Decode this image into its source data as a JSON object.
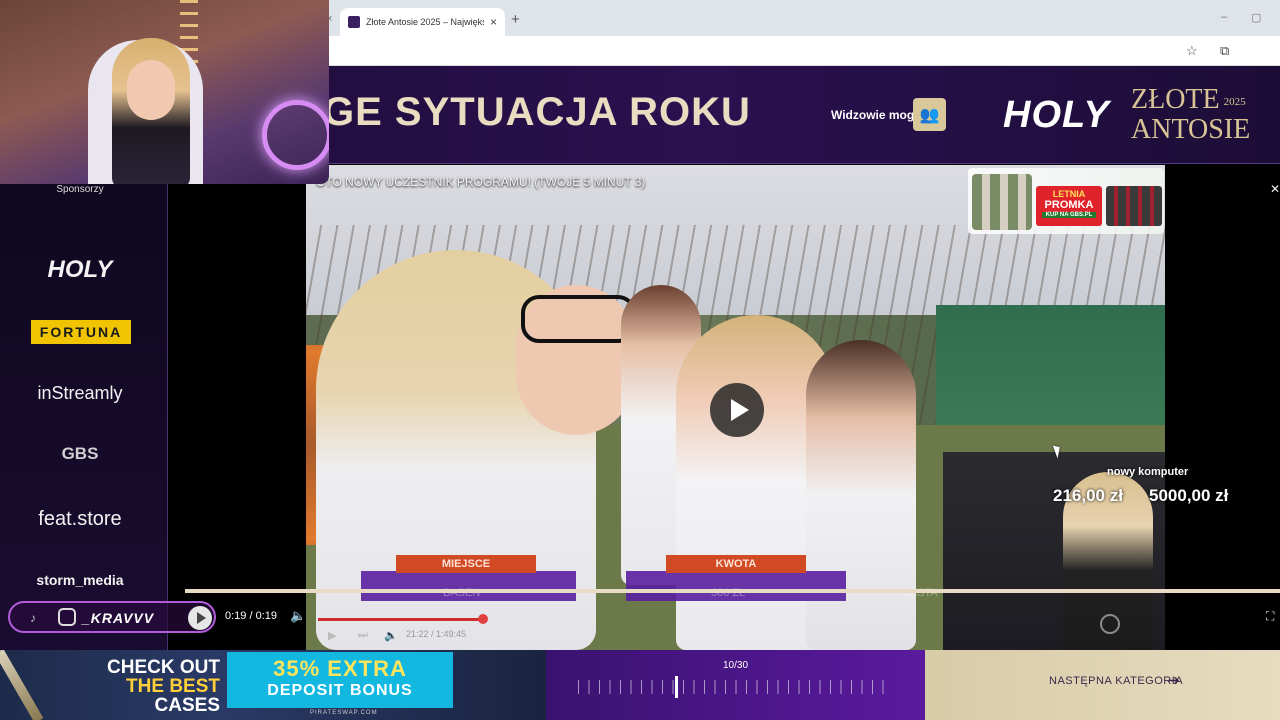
{
  "browser": {
    "tab_title": "Złote Antosie 2025 – Największ",
    "tab_close": "×",
    "prev_tab_close": "×",
    "new_tab": "+",
    "minimize": "–",
    "maximize": "▢",
    "star_icon": "☆",
    "extensions_icon": "⧉"
  },
  "header": {
    "category_title": "GE SYTUACJA ROKU",
    "viewers_label": "Widzowie mogą",
    "brand_logo": "HOLY",
    "event_name_line1": "ZŁOTE",
    "event_name_line2": "ANTOSIE",
    "event_year": "2025"
  },
  "sponsors": {
    "label": "Sponsorzy",
    "items": [
      "HOLY",
      "FORTUNA",
      "inStreamly",
      "GBS",
      "feat.store",
      "storm_media"
    ]
  },
  "video": {
    "caption": "OTO NOWY UCZESTNIK PROGRAMU! (TWOJE 5 MINUT 3)",
    "promo": {
      "line1": "LETNIA",
      "line2": "PROMKA",
      "line3": "KUP NA GBS.PL"
    },
    "hud": {
      "tag1": "MIEJSCE",
      "tag2": "KWOTA",
      "sub1": "BASEN",
      "sub2": "300 ZŁ",
      "sub3": "ZESTA"
    },
    "inner_time": "21:22 / 1:49:45"
  },
  "donation_goal": {
    "label": "nowy komputer",
    "current": "216,00 zł",
    "target": "5000,00 zł"
  },
  "player": {
    "time": "0:19 / 0:19",
    "volume_icon": "🔈",
    "fullscreen_icon": "⛶",
    "streamer_handle": "_KRAVVV",
    "progress": 1.0
  },
  "bottom": {
    "ad": {
      "line1": "CHECK OUT",
      "line2": "THE BEST",
      "line3": "CASES",
      "bonus1": "35% EXTRA",
      "bonus2": "DEPOSIT BONUS",
      "site": "PIRATESWAP.COM"
    },
    "category_counter": "10/30",
    "current_category_index": 10,
    "total_categories": 30,
    "next_category_label": "NASTĘPNA KATEGORIA",
    "next_arrow": "➔"
  },
  "colors": {
    "banner_bg": "#2a1150",
    "gold": "#d8c494",
    "accent_purple": "#5a1a9e",
    "fortuna_yellow": "#f0c400"
  }
}
